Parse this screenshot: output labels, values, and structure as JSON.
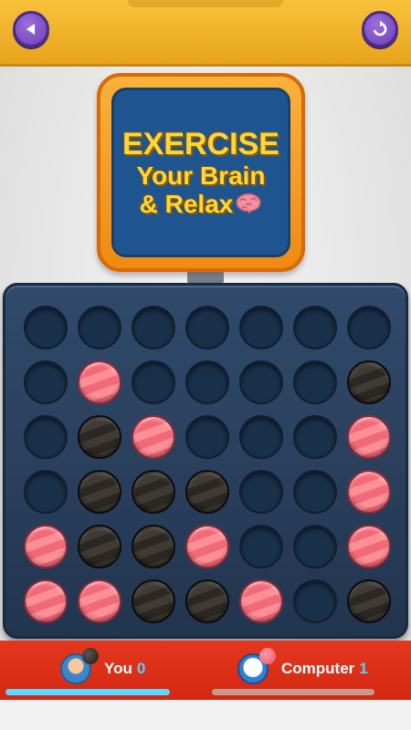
{
  "header": {
    "back_button": "back-arrow-icon",
    "restart_button": "restart-icon"
  },
  "banner": {
    "line1": "EXERCISE",
    "line2": "Your Brain",
    "line3": "& Relax",
    "icon": "brain-icon"
  },
  "board": {
    "rows": 6,
    "cols": 7,
    "cells": [
      [
        "",
        "",
        "",
        "",
        "",
        "",
        ""
      ],
      [
        "",
        "R",
        "",
        "",
        "",
        "",
        "B"
      ],
      [
        "",
        "B",
        "R",
        "",
        "",
        "",
        "R"
      ],
      [
        "",
        "B",
        "B",
        "B",
        "",
        "",
        "R"
      ],
      [
        "R",
        "B",
        "B",
        "R",
        "",
        "",
        "R"
      ],
      [
        "R",
        "R",
        "B",
        "B",
        "R",
        "",
        "B"
      ]
    ]
  },
  "players": {
    "you": {
      "name": "You",
      "score": "0",
      "chip": "black"
    },
    "computer": {
      "name": "Computer",
      "score": "1",
      "chip": "red"
    }
  },
  "colors": {
    "red_disc": "#f16a78",
    "black_disc": "#2b2722",
    "board": "#2a3f5e",
    "score_bar": "#d9301a",
    "score_accent": "#4fd4ff"
  }
}
